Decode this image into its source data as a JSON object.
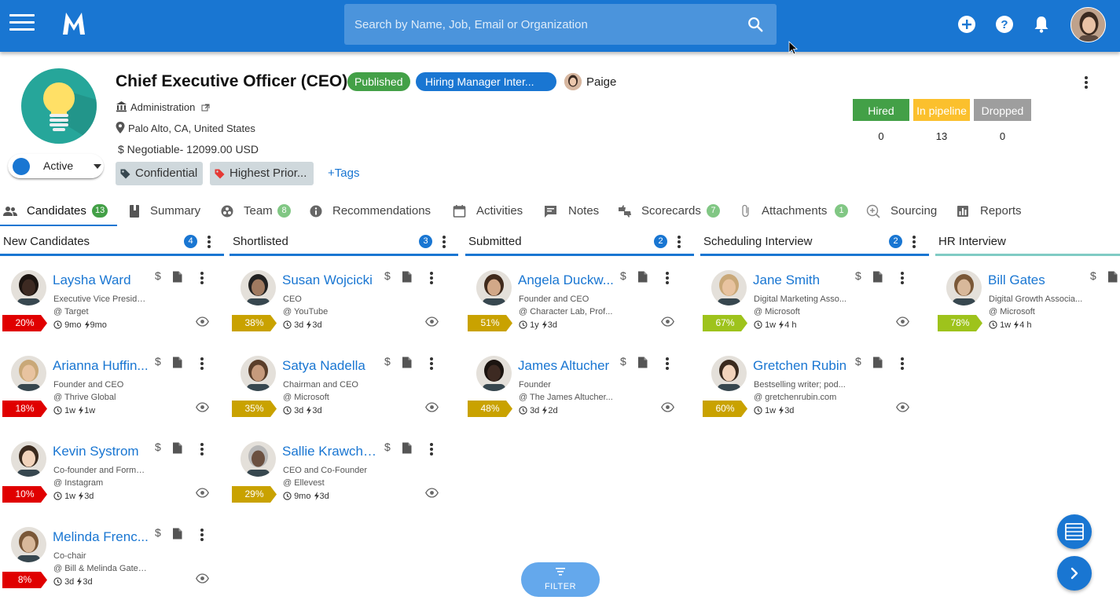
{
  "header": {
    "search_placeholder": "Search by Name, Job, Email or Organization"
  },
  "job": {
    "title": "Chief Executive Officer (CEO)",
    "published_label": "Published",
    "stage_label": "Hiring Manager Inter...",
    "owner_name": "Paige",
    "department": "Administration",
    "location": "Palo Alto, CA, United States",
    "salary": "$ Negotiable- 12099.00 USD",
    "status": "Active",
    "tags": [
      "Confidential",
      "Highest Prior..."
    ],
    "add_tags_label": "+Tags"
  },
  "stats": [
    {
      "label": "Hired",
      "value": "0",
      "color": "#43a047"
    },
    {
      "label": "In pipeline",
      "value": "13",
      "color": "#fbc02d"
    },
    {
      "label": "Dropped",
      "value": "0",
      "color": "#9e9e9e"
    }
  ],
  "tabs": [
    {
      "label": "Candidates",
      "badge": "13"
    },
    {
      "label": "Summary",
      "badge": ""
    },
    {
      "label": "Team",
      "badge": "8"
    },
    {
      "label": "Recommendations",
      "badge": ""
    },
    {
      "label": "Activities",
      "badge": ""
    },
    {
      "label": "Notes",
      "badge": ""
    },
    {
      "label": "Scorecards",
      "badge": "7"
    },
    {
      "label": "Attachments",
      "badge": "1"
    },
    {
      "label": "Sourcing",
      "badge": ""
    },
    {
      "label": "Reports",
      "badge": ""
    }
  ],
  "columns": [
    {
      "title": "New Candidates",
      "count": "4",
      "cards": [
        {
          "name": "Laysha Ward",
          "role": "Executive Vice Preside...",
          "org": "@ Target",
          "score": "20%",
          "score_color": "#e00000",
          "t1": "9mo",
          "t2": "9mo"
        },
        {
          "name": "Arianna Huffin...",
          "role": "Founder and CEO",
          "org": "@ Thrive Global",
          "score": "18%",
          "score_color": "#e00000",
          "t1": "1w",
          "t2": "1w"
        },
        {
          "name": "Kevin Systrom",
          "role": "Co-founder and Forme...",
          "org": "@ Instagram",
          "score": "10%",
          "score_color": "#e00000",
          "t1": "1w",
          "t2": "3d"
        },
        {
          "name": "Melinda Frenc...",
          "role": "Co-chair",
          "org": "@ Bill & Melinda Gates...",
          "score": "8%",
          "score_color": "#e00000",
          "t1": "3d",
          "t2": "3d"
        }
      ]
    },
    {
      "title": "Shortlisted",
      "count": "3",
      "cards": [
        {
          "name": "Susan Wojcicki",
          "role": "CEO",
          "org": "@ YouTube",
          "score": "38%",
          "score_color": "#c9a200",
          "t1": "3d",
          "t2": "3d"
        },
        {
          "name": "Satya Nadella",
          "role": "Chairman and CEO",
          "org": "@ Microsoft",
          "score": "35%",
          "score_color": "#c9a200",
          "t1": "3d",
          "t2": "3d"
        },
        {
          "name": "Sallie Krawche...",
          "role": "CEO and Co-Founder",
          "org": "@ Ellevest",
          "score": "29%",
          "score_color": "#c9a200",
          "t1": "9mo",
          "t2": "3d"
        }
      ]
    },
    {
      "title": "Submitted",
      "count": "2",
      "cards": [
        {
          "name": "Angela Duckw...",
          "role": "Founder and CEO",
          "org": "@ Character Lab, Prof...",
          "score": "51%",
          "score_color": "#c9a200",
          "t1": "1y",
          "t2": "3d"
        },
        {
          "name": "James Altucher",
          "role": "Founder",
          "org": "@ The James Altucher...",
          "score": "48%",
          "score_color": "#c9a200",
          "t1": "3d",
          "t2": "2d"
        }
      ]
    },
    {
      "title": "Scheduling Interview",
      "count": "2",
      "cards": [
        {
          "name": "Jane Smith",
          "role": "Digital Marketing Asso...",
          "org": "@ Microsoft",
          "score": "67%",
          "score_color": "#9ec31c",
          "t1": "1w",
          "t2": "4 h"
        },
        {
          "name": "Gretchen Rubin",
          "role": "Bestselling writer; pod...",
          "org": "@ gretchenrubin.com",
          "score": "60%",
          "score_color": "#c9a200",
          "t1": "1w",
          "t2": "3d"
        }
      ]
    },
    {
      "title": "HR Interview",
      "count": "",
      "cards": [
        {
          "name": "Bill Gates",
          "role": "Digital Growth Associa...",
          "org": "@ Microsoft",
          "score": "78%",
          "score_color": "#9ec31c",
          "t1": "1w",
          "t2": "4 h"
        }
      ]
    }
  ],
  "filter_label": "FILTER"
}
